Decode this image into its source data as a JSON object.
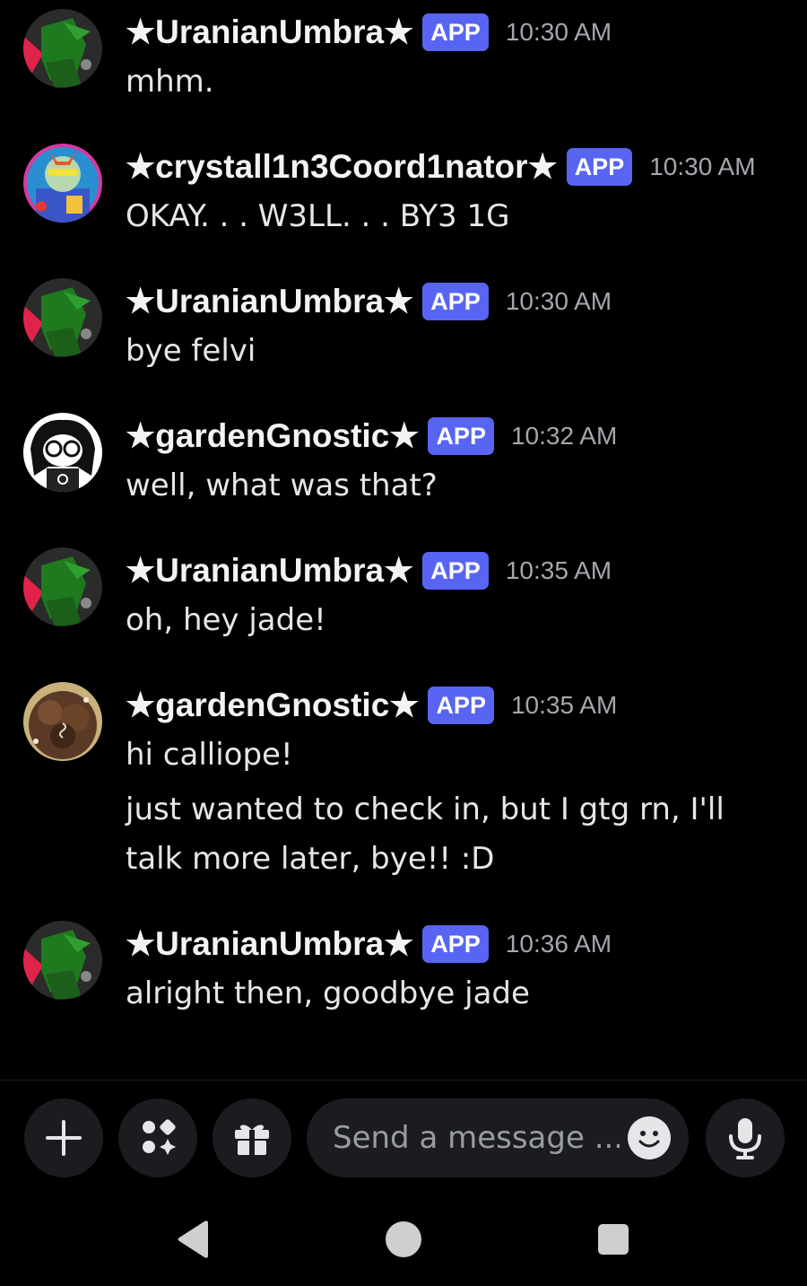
{
  "colors": {
    "background": "#000000",
    "app_badge": "#5865f2",
    "timestamp": "#a4a7ad",
    "input_bg": "#1b1c20"
  },
  "messages": [
    {
      "author": "★UranianUmbra★",
      "badge": "APP",
      "time": "10:30 AM",
      "avatar": "uranian-avatar",
      "lines": [
        "mhm."
      ]
    },
    {
      "author": "★crystall1n3Coord1nator★",
      "badge": "APP",
      "time": "10:30 AM",
      "avatar": "crystal-avatar",
      "lines": [
        "OKAY. . . W3LL. . . BY3 1G"
      ]
    },
    {
      "author": "★UranianUmbra★",
      "badge": "APP",
      "time": "10:30 AM",
      "avatar": "uranian-avatar",
      "lines": [
        "bye felvi"
      ]
    },
    {
      "author": "★gardenGnostic★",
      "badge": "APP",
      "time": "10:32 AM",
      "avatar": "garden-avatar-bw",
      "lines": [
        "well, what was that?"
      ]
    },
    {
      "author": "★UranianUmbra★",
      "badge": "APP",
      "time": "10:35 AM",
      "avatar": "uranian-avatar",
      "lines": [
        "oh, hey jade!"
      ]
    },
    {
      "author": "★gardenGnostic★",
      "badge": "APP",
      "time": "10:35 AM",
      "avatar": "garden-avatar-brown",
      "lines": [
        "hi calliope!",
        "just wanted to check in, but I gtg rn, I'll talk more later, bye!! :D"
      ]
    },
    {
      "author": "★UranianUmbra★",
      "badge": "APP",
      "time": "10:36 AM",
      "avatar": "uranian-avatar",
      "lines": [
        "alright then, goodbye jade"
      ]
    }
  ],
  "composer": {
    "placeholder": "Send a message ...",
    "buttons": [
      "plus-icon",
      "apps-icon",
      "gift-icon",
      "emoji-icon",
      "microphone-icon"
    ]
  },
  "navbar": [
    "back-icon",
    "home-icon",
    "recents-icon"
  ]
}
